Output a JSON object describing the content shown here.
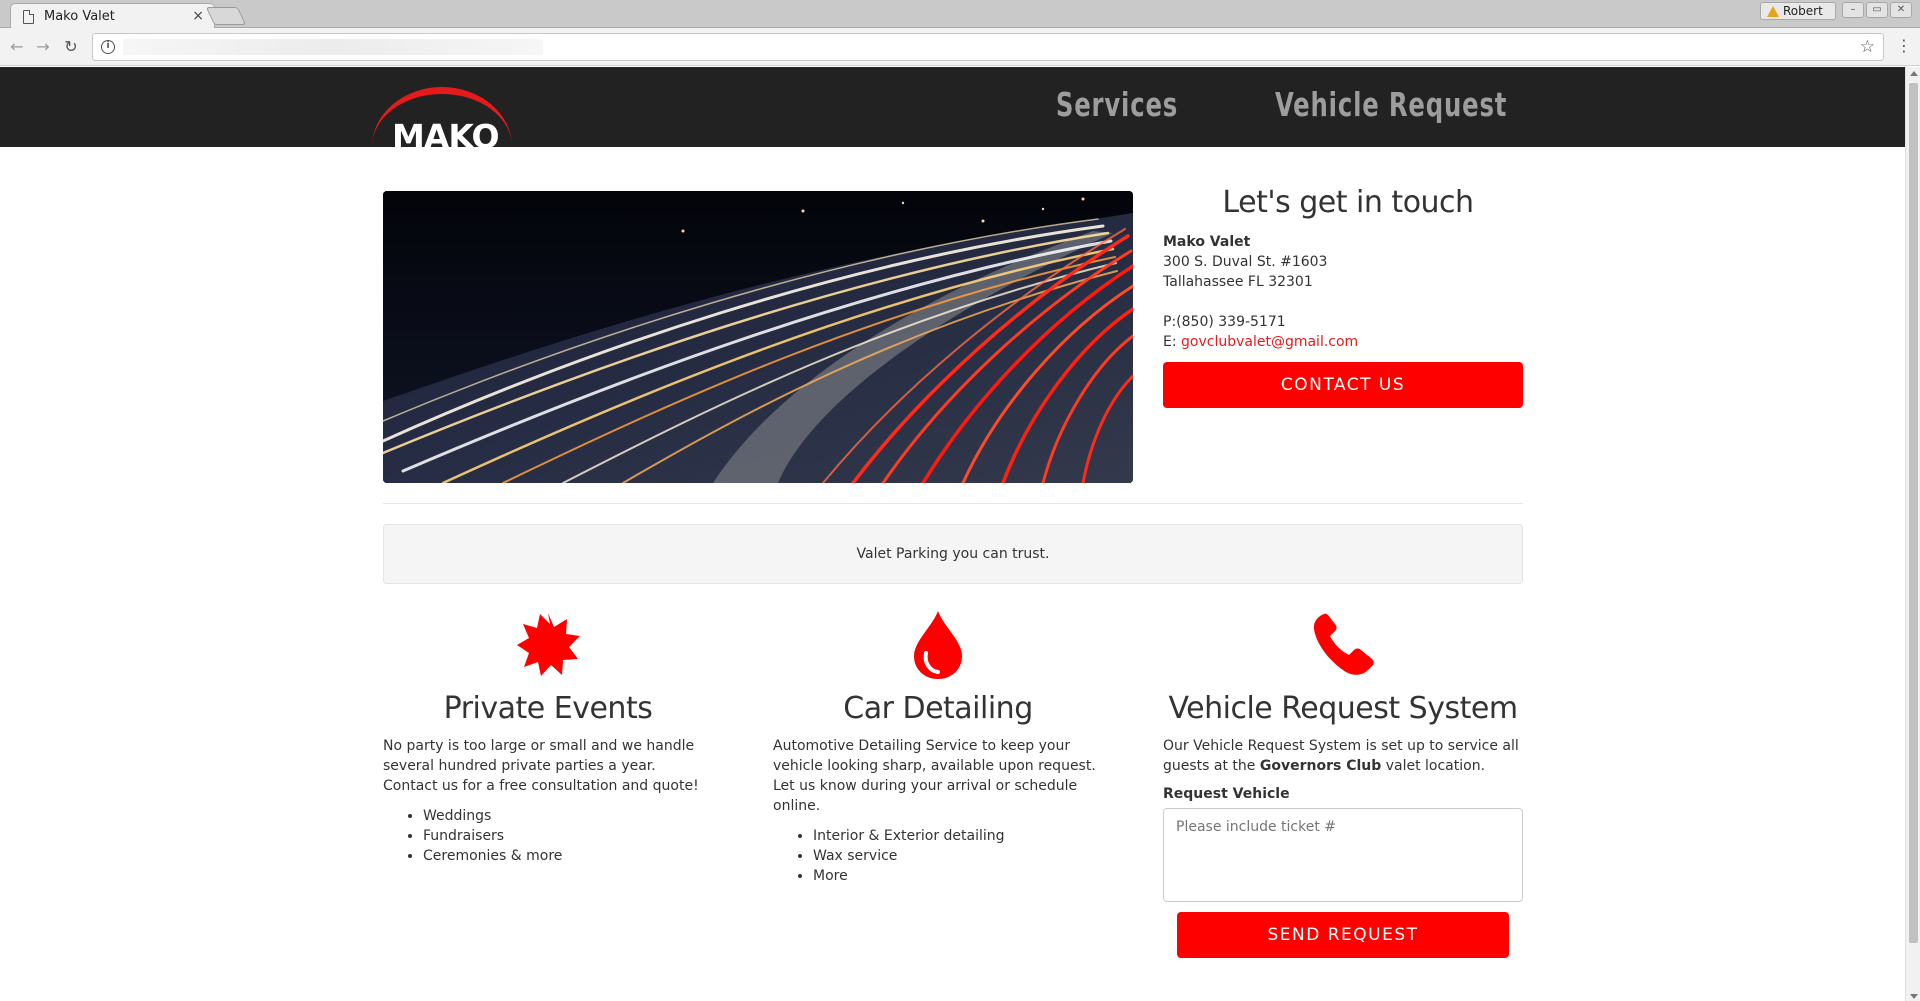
{
  "browser": {
    "tab_title": "Mako Valet",
    "tab_close": "×",
    "profile_name": "Robert",
    "window_controls": [
      "–",
      "▭",
      "✕"
    ],
    "back": "←",
    "forward": "→",
    "reload": "↻",
    "info_glyph": "i",
    "star": "☆",
    "menu": "⋮"
  },
  "site": {
    "logo_text": "MAKO",
    "nav": [
      "Services",
      "Vehicle Request"
    ]
  },
  "contact": {
    "heading": "Let's get in touch",
    "company": "Mako Valet",
    "address1": "300 S. Duval St. #1603",
    "address2": "Tallahassee FL 32301",
    "phone_label": "P:",
    "phone": "(850) 339-5171",
    "email_label": "E: ",
    "email": "govclubvalet@gmail.com",
    "button": "CONTACT US"
  },
  "tagline": "Valet Parking you can trust.",
  "columns": {
    "events": {
      "icon": "starburst-icon",
      "title": "Private Events",
      "text": "No party is too large or small and we handle several hundred private parties a year. Contact us for a free consultation and quote!",
      "items": [
        "Weddings",
        "Fundraisers",
        "Ceremonies & more"
      ]
    },
    "detailing": {
      "icon": "drop-icon",
      "title": "Car Detailing",
      "text": "Automotive Detailing Service to keep your vehicle looking sharp, available upon request. Let us know during your arrival or schedule online.",
      "items": [
        "Interior & Exterior detailing",
        "Wax service",
        "More"
      ]
    },
    "request": {
      "icon": "phone-icon",
      "title": "Vehicle Request System",
      "text_before": "Our Vehicle Request System is set up to service all guests at the ",
      "text_bold": "Governors Club",
      "text_after": " valet location.",
      "label": "Request Vehicle",
      "placeholder": "Please include ticket #",
      "button": "SEND REQUEST"
    }
  },
  "colors": {
    "accent": "#ff0000",
    "nav_bg": "#222222",
    "nav_text": "#9d9d9d"
  }
}
